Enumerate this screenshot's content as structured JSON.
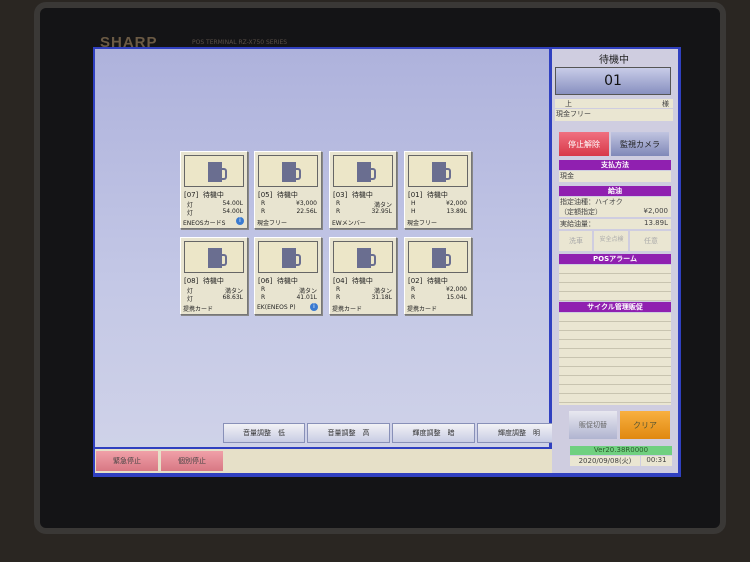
{
  "device": {
    "brand": "SHARP",
    "model": "POS TERMINAL RZ-X750 SERIES"
  },
  "pumps": [
    {
      "id": "[07]",
      "status": "待機中",
      "row1": [
        "灯",
        "54.00L"
      ],
      "row2": [
        "灯",
        "54.00L"
      ],
      "footer": "ENEOSカードS",
      "info": true
    },
    {
      "id": "[05]",
      "status": "待機中",
      "row1": [
        "R",
        "¥3,000"
      ],
      "row2": [
        "R",
        "22.56L"
      ],
      "footer": "現金フリー",
      "info": false
    },
    {
      "id": "[03]",
      "status": "待機中",
      "row1": [
        "R",
        "満タン"
      ],
      "row2": [
        "R",
        "32.95L"
      ],
      "footer": "EWメンバー",
      "info": false
    },
    {
      "id": "[01]",
      "status": "待機中",
      "row1": [
        "H",
        "¥2,000"
      ],
      "row2": [
        "H",
        "13.89L"
      ],
      "footer": "現金フリー",
      "info": false
    },
    {
      "id": "[08]",
      "status": "待機中",
      "row1": [
        "灯",
        "満タン"
      ],
      "row2": [
        "灯",
        "68.63L"
      ],
      "footer": "提携カード",
      "info": false
    },
    {
      "id": "[06]",
      "status": "待機中",
      "row1": [
        "R",
        "満タン"
      ],
      "row2": [
        "R",
        "41.01L"
      ],
      "footer": "EK(ENEOS P)",
      "info": true
    },
    {
      "id": "[04]",
      "status": "待機中",
      "row1": [
        "R",
        "満タン"
      ],
      "row2": [
        "R",
        "31.18L"
      ],
      "footer": "提携カード",
      "info": false
    },
    {
      "id": "[02]",
      "status": "待機中",
      "row1": [
        "R",
        "¥2,000"
      ],
      "row2": [
        "R",
        "15.04L"
      ],
      "footer": "提携カード",
      "info": false
    }
  ],
  "toolbar": {
    "vol_low": "音量調整　低",
    "vol_high": "音量調整　高",
    "bright_dark": "輝度調整　暗",
    "bright_light": "輝度調整　明"
  },
  "bottom": {
    "emergency_stop": "緊急停止",
    "individual_stop": "個別停止"
  },
  "side": {
    "status": "待機中",
    "pump_no": "01",
    "customer_top": "上",
    "customer_suffix": "様",
    "customer_type": "現金フリー",
    "release": "停止解除",
    "camera": "監視カメラ",
    "payment_header": "支払方法",
    "payment": "現金",
    "fuel_header": "給油",
    "fuel_type": "指定油種：ハイオク",
    "fixed_label": "（定額指定）",
    "fixed_amount": "¥2,000",
    "actual_label": "実給油量：",
    "actual_amount": "13.89L",
    "wash": "洗車",
    "safety": "安全点検",
    "optional": "任意",
    "alarm_header": "POSアラーム",
    "cycle_header": "サイクル管理販促",
    "promo_switch": "販促切替",
    "clear": "クリア",
    "version": "Ver20.38R0000",
    "date": "2020/09/08(火)",
    "time": "00:31"
  },
  "colors": {
    "accent_purple": "#9020b0",
    "clear_orange": "#f0a020",
    "stop_red": "#e05060",
    "version_green": "#70d080"
  }
}
